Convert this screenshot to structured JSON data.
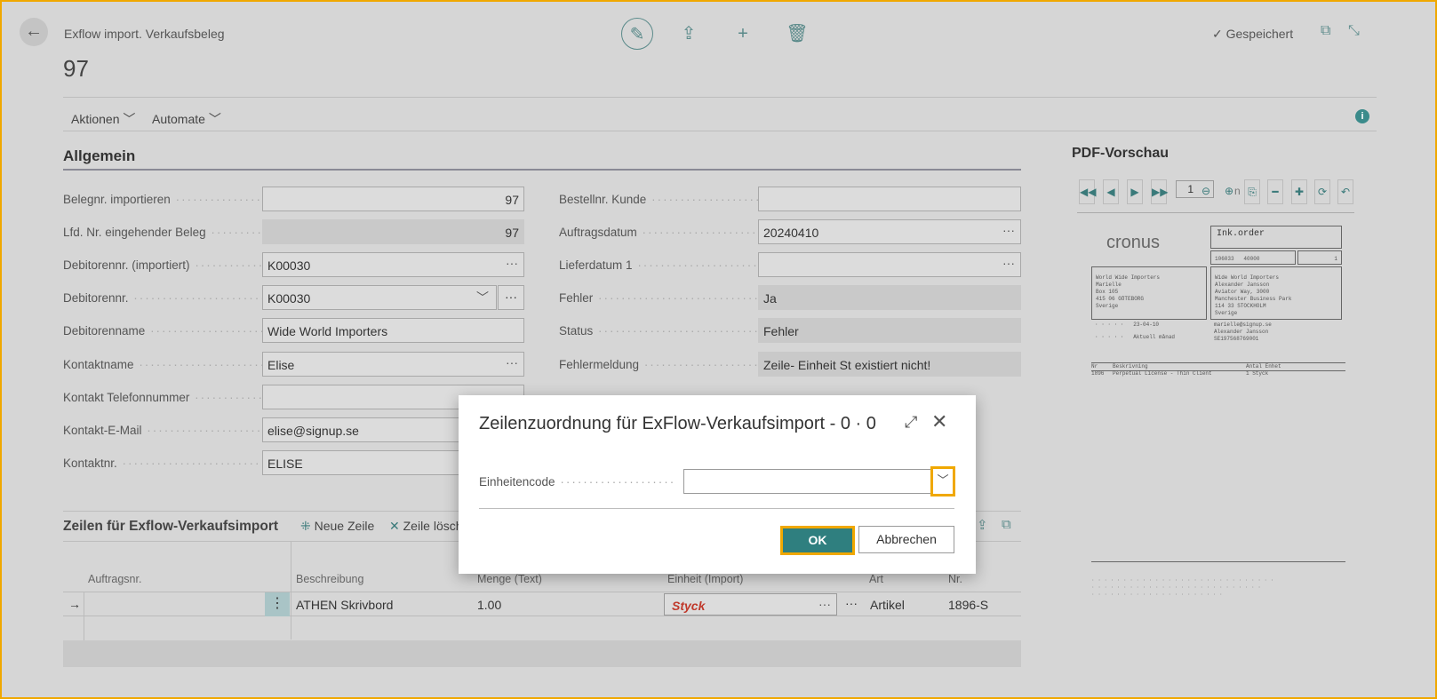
{
  "header": {
    "subtitle": "Exflow import. Verkaufsbeleg",
    "number": "97",
    "saved": "Gespeichert"
  },
  "icons": {
    "back": "arrow-left-icon",
    "edit": "pencil-icon",
    "share": "share-icon",
    "new": "plus-icon",
    "delete": "trash-icon",
    "popout": "open-new-window-icon",
    "collapse": "collapse-icon",
    "info": "info-icon"
  },
  "menu": {
    "actions": "Aktionen",
    "automate": "Automate",
    "info": "i"
  },
  "general": {
    "title": "Allgemein",
    "left": [
      {
        "label": "Belegnr. importieren",
        "value": "97",
        "readonly": false,
        "align": "right"
      },
      {
        "label": "Lfd. Nr. eingehender Beleg",
        "value": "97",
        "readonly": true,
        "align": "right"
      },
      {
        "label": "Debitorennr. (importiert)",
        "value": "K00030",
        "readonly": false
      },
      {
        "label": "Debitorennr.",
        "value": "K00030",
        "readonly": false
      },
      {
        "label": "Debitorenname",
        "value": "Wide World Importers",
        "readonly": false
      },
      {
        "label": "Kontaktname",
        "value": "Elise",
        "readonly": false
      },
      {
        "label": "Kontakt Telefonnummer",
        "value": "",
        "readonly": false
      },
      {
        "label": "Kontakt-E-Mail",
        "value": "elise@signup.se",
        "readonly": false
      },
      {
        "label": "Kontaktnr.",
        "value": "ELISE",
        "readonly": false
      }
    ],
    "right": [
      {
        "label": "Bestellnr. Kunde",
        "value": ""
      },
      {
        "label": "Auftragsdatum",
        "value": "20240410"
      },
      {
        "label": "Lieferdatum 1",
        "value": ""
      },
      {
        "label": "Fehler",
        "value": "Ja"
      },
      {
        "label": "Status",
        "value": "Fehler"
      },
      {
        "label": "Fehlermeldung",
        "value": "Zeile- Einheit St existiert nicht!"
      }
    ]
  },
  "pdf": {
    "title": "PDF-Vorschau",
    "page": "1",
    "of": "n",
    "logo": "cronus",
    "doc_title": "Ink.order",
    "order_no": "106033",
    "customer_no": "40000",
    "page_no": "1",
    "bill_to": [
      "World Wide Importers",
      "Marielle",
      "Box 105",
      "415 06 GÖTEBORG",
      "Sverige"
    ],
    "ship_to": [
      "Wide World Importers",
      "Alexander Jansson",
      "Aviator Way, 3000",
      "Manchester Business Park",
      "114 33 STOCKHOLM",
      "Sverige"
    ],
    "order_date": "23-04-10",
    "delivery": "Aktuell månad",
    "email": "marielle@signup.se",
    "contact": "Alexander Jansson",
    "vat": "SE197568769001",
    "line_header": [
      "Nr",
      "Beskrivning",
      "Antal Enhet"
    ],
    "line": [
      "1896",
      "Perpetual License - Thin Client",
      "1 Styck"
    ]
  },
  "lines": {
    "title": "Zeilen für Exflow-Verkaufsimport",
    "new_line": "Neue Zeile",
    "delete_line": "Zeile lösch",
    "columns": [
      "Auftragsnr.",
      "Beschreibung",
      "Menge (Text)",
      "Einheit (Import)",
      "Art",
      "Nr."
    ],
    "rows": [
      {
        "order": "",
        "description": "ATHEN Skrivbord",
        "qty": "1.00",
        "unit": "Styck",
        "type": "Artikel",
        "no": "1896-S"
      }
    ]
  },
  "dialog": {
    "title": "Zeilenzuordnung für ExFlow-Verkaufsimport - 0 · 0",
    "field_label": "Einheitencode",
    "field_value": "",
    "ok": "OK",
    "cancel": "Abbrechen"
  },
  "colors": {
    "accent": "#2f7f7f",
    "highlight": "#f0a800",
    "error_text": "#c0392b"
  }
}
